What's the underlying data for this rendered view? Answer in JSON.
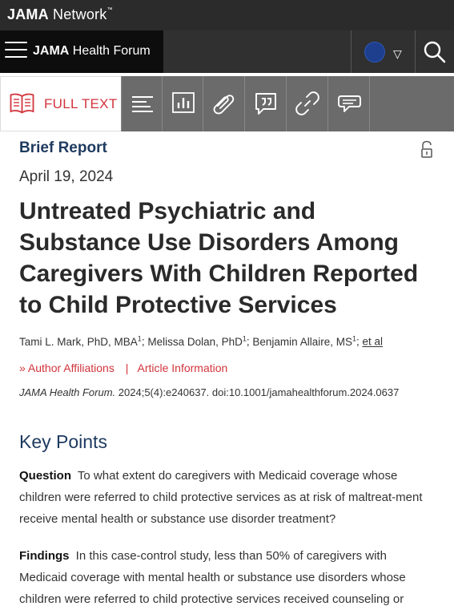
{
  "topbar": {
    "brand_bold": "JAMA",
    "brand_rest": "Network",
    "brand_mark": "™"
  },
  "navbar": {
    "journal_bold": "JAMA",
    "journal_rest": "Health Forum"
  },
  "tabs": {
    "full_text_label": "FULL TEXT"
  },
  "article": {
    "type": "Brief Report",
    "date": "April 19, 2024",
    "title": "Untreated Psychiatric and Substance Use Disorders Among Caregivers With Children Reported to Child Protective Services",
    "authors": [
      {
        "name": "Tami L. Mark, PhD, MBA",
        "sup": "1"
      },
      {
        "name": "Melissa Dolan, PhD",
        "sup": "1"
      },
      {
        "name": "Benjamin Allaire, MS",
        "sup": "1"
      }
    ],
    "et_al": "et al",
    "author_affiliations_label": "Author Affiliations",
    "article_info_label": "Article Information",
    "journal_citation": "JAMA Health Forum.",
    "citation_rest": "2024;5(4):e240637. doi:10.1001/jamahealthforum.2024.0637"
  },
  "key_points": {
    "heading": "Key Points",
    "question_label": "Question",
    "question_text": "To what extent do caregivers with Medicaid coverage whose children were referred to child protective services as at risk of maltreat-ment receive mental health or substance use disorder treatment?",
    "findings_label": "Findings",
    "findings_text": "In this case-control study, less than 50% of caregivers with Medicaid coverage with mental health or substance use disorders whose children were referred to child protective services received counseling or"
  },
  "colors": {
    "accent_red": "#d2343c",
    "navy": "#1e3a5f",
    "topbar": "#2b2b2b"
  },
  "icons": [
    "hamburger-icon",
    "globe-icon",
    "dropdown-triangle-icon",
    "search-icon",
    "book-icon",
    "outline-icon",
    "figures-icon",
    "attachment-icon",
    "comment-icon",
    "link-icon",
    "chat-icon",
    "unlock-icon",
    "chevron-double-icon"
  ]
}
